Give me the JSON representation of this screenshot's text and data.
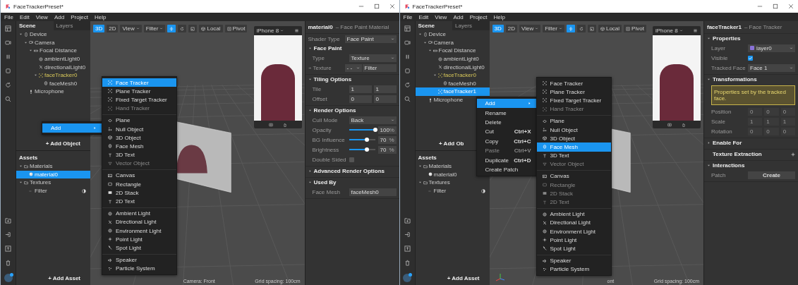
{
  "windows": [
    {
      "title": "FaceTrackerPreset*",
      "menu": [
        "File",
        "Edit",
        "View",
        "Add",
        "Project",
        "Help"
      ],
      "scene": {
        "tabs": [
          {
            "label": "Scene",
            "selected": true
          },
          {
            "label": "Layers",
            "selected": false
          }
        ],
        "tree": [
          {
            "label": "Device",
            "kind": "device",
            "expanded": true,
            "selected": false,
            "children": [
              {
                "label": "Camera",
                "kind": "camera",
                "expanded": true,
                "selected": false,
                "children": [
                  {
                    "label": "Focal Distance",
                    "kind": "focal",
                    "expanded": true,
                    "selected": false,
                    "children": [
                      {
                        "label": "ambientLight0",
                        "kind": "ambient",
                        "selected": false
                      },
                      {
                        "label": "directionalLight0",
                        "kind": "directional",
                        "selected": false
                      },
                      {
                        "label": "faceTracker0",
                        "kind": "tracker",
                        "expanded": true,
                        "selected": false,
                        "children": [
                          {
                            "label": "faceMesh0",
                            "kind": "mesh",
                            "selected": false
                          }
                        ]
                      }
                    ]
                  }
                ]
              },
              {
                "label": "Microphone",
                "kind": "microphone",
                "selected": false
              }
            ]
          }
        ],
        "add_object": "+ Add Object",
        "assets_title": "Assets",
        "assets": [
          {
            "label": "Materials",
            "kind": "folder",
            "expanded": true,
            "selected": false,
            "children": [
              {
                "label": "material0",
                "kind": "material",
                "selected": true
              }
            ]
          },
          {
            "label": "Textures",
            "kind": "folder",
            "expanded": true,
            "selected": false,
            "children": [
              {
                "label": "Filter",
                "kind": "texture",
                "selected": false
              }
            ]
          }
        ],
        "add_asset": "+ Add Asset"
      },
      "toolbar": {
        "modes": [
          {
            "label": "3D",
            "selected": true
          },
          {
            "label": "2D",
            "selected": false
          }
        ],
        "dropdowns": [
          "View",
          "Filter"
        ],
        "tools": [
          {
            "kind": "move",
            "selected": true
          },
          {
            "kind": "rotate",
            "selected": false
          },
          {
            "kind": "scale",
            "selected": false
          }
        ],
        "toggles": [
          {
            "kind": "cube",
            "label": "Local"
          },
          {
            "kind": "pivot",
            "label": "Pivot"
          }
        ]
      },
      "simulator": {
        "device": "iPhone 8"
      },
      "status": {
        "camera": "Camera: Front",
        "grid": "Grid spacing: 100cm"
      },
      "context_menu": [
        {
          "label": "Add",
          "selected": true,
          "submenu": true,
          "disabled": false
        }
      ],
      "submenu": [
        [
          {
            "label": "Face Tracker",
            "kind": "tracker",
            "selected": true,
            "disabled": false
          },
          {
            "label": "Plane Tracker",
            "kind": "tracker",
            "selected": false,
            "disabled": false
          },
          {
            "label": "Fixed Target Tracker",
            "kind": "tracker",
            "selected": false,
            "disabled": false
          },
          {
            "label": "Hand Tracker",
            "kind": "tracker",
            "selected": false,
            "disabled": true
          }
        ],
        [
          {
            "label": "Plane",
            "kind": "plane",
            "selected": false,
            "disabled": false
          },
          {
            "label": "Null Object",
            "kind": "null",
            "selected": false,
            "disabled": false
          },
          {
            "label": "3D Object",
            "kind": "object",
            "selected": false,
            "disabled": false
          },
          {
            "label": "Face Mesh",
            "kind": "mesh",
            "selected": false,
            "disabled": false
          },
          {
            "label": "3D Text",
            "kind": "text",
            "selected": false,
            "disabled": false
          },
          {
            "label": "Vector Object",
            "kind": "vector",
            "selected": false,
            "disabled": true
          }
        ],
        [
          {
            "label": "Canvas",
            "kind": "canvas",
            "selected": false,
            "disabled": false
          },
          {
            "label": "Rectangle",
            "kind": "rectangle",
            "selected": false,
            "disabled": false
          },
          {
            "label": "2D Stack",
            "kind": "stack",
            "selected": false,
            "disabled": false
          },
          {
            "label": "2D Text",
            "kind": "text",
            "selected": false,
            "disabled": false
          }
        ],
        [
          {
            "label": "Ambient Light",
            "kind": "ambient",
            "selected": false,
            "disabled": false
          },
          {
            "label": "Directional Light",
            "kind": "directional",
            "selected": false,
            "disabled": false
          },
          {
            "label": "Environment Light",
            "kind": "ambient",
            "selected": false,
            "disabled": false
          },
          {
            "label": "Point Light",
            "kind": "point",
            "selected": false,
            "disabled": false
          },
          {
            "label": "Spot Light",
            "kind": "spot",
            "selected": false,
            "disabled": false
          }
        ],
        [
          {
            "label": "Speaker",
            "kind": "speaker",
            "selected": false,
            "disabled": false
          },
          {
            "label": "Particle System",
            "kind": "particle",
            "selected": false,
            "disabled": false
          }
        ]
      ],
      "inspector": {
        "title": "material0",
        "subtitle": "– Face Paint Material",
        "rows": [
          {
            "kind": "dropdown",
            "label": "Shader Type",
            "value": "Face Paint"
          }
        ],
        "sections": [
          {
            "kind": "collapsible",
            "title": "Face Paint",
            "expanded": true,
            "rows": [
              {
                "kind": "dropdown",
                "label": "Type",
                "value": "Texture"
              },
              {
                "kind": "texture",
                "label": "Texture",
                "picker": "- -",
                "value": "Filter"
              }
            ]
          },
          {
            "kind": "collapsible",
            "title": "Tiling Options",
            "expanded": true,
            "rows": [
              {
                "kind": "fields",
                "label": "Tile",
                "values": [
                  "1",
                  "1"
                ],
                "disabled": false
              },
              {
                "kind": "fields",
                "label": "Offset",
                "values": [
                  "0",
                  "0"
                ],
                "disabled": false
              }
            ]
          },
          {
            "kind": "collapsible",
            "title": "Render Options",
            "expanded": true,
            "rows": [
              {
                "kind": "dropdown",
                "label": "Cull Mode",
                "value": "Back"
              },
              {
                "kind": "slider",
                "label": "Opacity",
                "level": 1,
                "value": "100",
                "unit": "%"
              },
              {
                "kind": "slider",
                "label": "BG Influence",
                "level": 0.7,
                "value": "70",
                "unit": "%"
              },
              {
                "kind": "slider",
                "label": "Brightness",
                "level": 0.7,
                "value": "70",
                "unit": "%"
              },
              {
                "kind": "checkbox",
                "label": "Double Sided",
                "checked": false
              }
            ]
          },
          {
            "kind": "collapsible",
            "title": "Advanced Render Options",
            "expanded": false
          },
          {
            "kind": "collapsible",
            "title": "Used By",
            "expanded": true,
            "rows": [
              {
                "kind": "field",
                "label": "Face Mesh",
                "value": "faceMesh0"
              }
            ]
          }
        ]
      }
    },
    {
      "title": "FaceTrackerPreset*",
      "menu": [
        "File",
        "Edit",
        "View",
        "Add",
        "Project",
        "Help"
      ],
      "scene": {
        "tabs": [
          {
            "label": "Scene",
            "selected": true
          },
          {
            "label": "Layers",
            "selected": false
          }
        ],
        "tree": [
          {
            "label": "Device",
            "kind": "device",
            "expanded": true,
            "selected": false,
            "children": [
              {
                "label": "Camera",
                "kind": "camera",
                "expanded": true,
                "selected": false,
                "children": [
                  {
                    "label": "Focal Distance",
                    "kind": "focal",
                    "expanded": true,
                    "selected": false,
                    "children": [
                      {
                        "label": "ambientLight0",
                        "kind": "ambient",
                        "selected": false
                      },
                      {
                        "label": "directionalLight0",
                        "kind": "directional",
                        "selected": false
                      },
                      {
                        "label": "faceTracker0",
                        "kind": "tracker",
                        "expanded": true,
                        "selected": false,
                        "children": [
                          {
                            "label": "faceMesh0",
                            "kind": "mesh",
                            "selected": false
                          }
                        ]
                      },
                      {
                        "label": "faceTracker1",
                        "kind": "tracker",
                        "selected": true
                      }
                    ]
                  }
                ]
              },
              {
                "label": "Microphone",
                "kind": "microphone",
                "selected": false
              }
            ]
          }
        ],
        "add_object": "+ Add Ob",
        "assets_title": "Assets",
        "assets": [
          {
            "label": "Materials",
            "kind": "folder",
            "expanded": true,
            "selected": false,
            "children": [
              {
                "label": "material0",
                "kind": "material",
                "selected": false
              }
            ]
          },
          {
            "label": "Textures",
            "kind": "folder",
            "expanded": true,
            "selected": false,
            "children": [
              {
                "label": "Filter",
                "kind": "texture",
                "selected": false
              }
            ]
          }
        ],
        "add_asset": "+ Add Asset"
      },
      "toolbar": {
        "modes": [
          {
            "label": "3D",
            "selected": true
          },
          {
            "label": "2D",
            "selected": false
          }
        ],
        "dropdowns": [
          "View",
          "Filter"
        ],
        "tools": [
          {
            "kind": "move",
            "selected": true
          },
          {
            "kind": "rotate",
            "selected": false
          },
          {
            "kind": "scale",
            "selected": false
          }
        ],
        "toggles": [
          {
            "kind": "cube",
            "label": "Local"
          },
          {
            "kind": "pivot",
            "label": "Pivot"
          }
        ]
      },
      "simulator": {
        "device": "iPhone 8"
      },
      "status": {
        "camera": "ont",
        "grid": "Grid spacing: 100cm"
      },
      "context_menu": [
        {
          "label": "Add",
          "selected": true,
          "submenu": true,
          "disabled": false
        },
        {
          "label": "Rename",
          "selected": false,
          "disabled": false
        },
        {
          "label": "Delete",
          "selected": false,
          "disabled": false
        },
        {
          "label": "Cut",
          "shortcut": "Ctrl+X",
          "selected": false,
          "disabled": false
        },
        {
          "label": "Copy",
          "shortcut": "Ctrl+C",
          "selected": false,
          "disabled": false
        },
        {
          "label": "Paste",
          "shortcut": "Ctrl+V",
          "selected": false,
          "disabled": true
        },
        {
          "label": "Duplicate",
          "shortcut": "Ctrl+D",
          "selected": false,
          "disabled": false
        },
        {
          "label": "Create Patch",
          "selected": false,
          "disabled": false
        }
      ],
      "submenu": [
        [
          {
            "label": "Face Tracker",
            "kind": "tracker",
            "selected": false,
            "disabled": false
          },
          {
            "label": "Plane Tracker",
            "kind": "tracker",
            "selected": false,
            "disabled": false
          },
          {
            "label": "Fixed Target Tracker",
            "kind": "tracker",
            "selected": false,
            "disabled": false
          },
          {
            "label": "Hand Tracker",
            "kind": "tracker",
            "selected": false,
            "disabled": true
          }
        ],
        [
          {
            "label": "Plane",
            "kind": "plane",
            "selected": false,
            "disabled": false
          },
          {
            "label": "Null Object",
            "kind": "null",
            "selected": false,
            "disabled": false
          },
          {
            "label": "3D Object",
            "kind": "object",
            "selected": false,
            "disabled": false
          },
          {
            "label": "Face Mesh",
            "kind": "mesh",
            "selected": true,
            "disabled": false
          },
          {
            "label": "3D Text",
            "kind": "text",
            "selected": false,
            "disabled": false
          },
          {
            "label": "Vector Object",
            "kind": "vector",
            "selected": false,
            "disabled": true
          }
        ],
        [
          {
            "label": "Canvas",
            "kind": "canvas",
            "selected": false,
            "disabled": false
          },
          {
            "label": "Rectangle",
            "kind": "rectangle",
            "selected": false,
            "disabled": true
          },
          {
            "label": "2D Stack",
            "kind": "stack",
            "selected": false,
            "disabled": true
          },
          {
            "label": "2D Text",
            "kind": "text",
            "selected": false,
            "disabled": true
          }
        ],
        [
          {
            "label": "Ambient Light",
            "kind": "ambient",
            "selected": false,
            "disabled": false
          },
          {
            "label": "Directional Light",
            "kind": "directional",
            "selected": false,
            "disabled": false
          },
          {
            "label": "Environment Light",
            "kind": "ambient",
            "selected": false,
            "disabled": false
          },
          {
            "label": "Point Light",
            "kind": "point",
            "selected": false,
            "disabled": false
          },
          {
            "label": "Spot Light",
            "kind": "spot",
            "selected": false,
            "disabled": false
          }
        ],
        [
          {
            "label": "Speaker",
            "kind": "speaker",
            "selected": false,
            "disabled": false
          },
          {
            "label": "Particle System",
            "kind": "particle",
            "selected": false,
            "disabled": false
          }
        ]
      ],
      "inspector": {
        "title": "faceTracker1",
        "subtitle": "– Face Tracker",
        "sections": [
          {
            "kind": "collapsible",
            "title": "Properties",
            "expanded": true,
            "rows": [
              {
                "kind": "dropdown",
                "label": "Layer",
                "value": "layer0",
                "color": "#8a72d8"
              },
              {
                "kind": "checkbox",
                "label": "Visible",
                "checked": true
              },
              {
                "kind": "dropdown",
                "label": "Tracked Face",
                "value": "Face 1"
              }
            ]
          },
          {
            "kind": "collapsible",
            "title": "Transformations",
            "expanded": true,
            "rows": [
              {
                "kind": "notice",
                "text": "Properties set by the tracked face."
              },
              {
                "kind": "fields",
                "label": "Position",
                "values": [
                  "0",
                  "0",
                  "0"
                ],
                "disabled": true
              },
              {
                "kind": "fields",
                "label": "Scale",
                "values": [
                  "1",
                  "1",
                  "1"
                ],
                "disabled": true
              },
              {
                "kind": "fields",
                "label": "Rotation",
                "values": [
                  "0",
                  "0",
                  "0"
                ],
                "disabled": true
              }
            ]
          },
          {
            "kind": "collapsible",
            "title": "Enable For",
            "expanded": false
          },
          {
            "kind": "addable",
            "title": "Texture Extraction"
          },
          {
            "kind": "collapsible",
            "title": "Interactions",
            "expanded": true,
            "rows": [
              {
                "kind": "button",
                "label": "Patch",
                "value": "Create"
              }
            ]
          }
        ]
      }
    }
  ]
}
